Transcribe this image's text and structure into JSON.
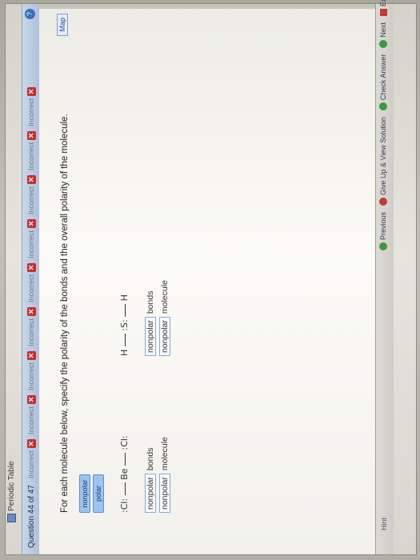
{
  "header": {
    "periodic_label": "Periodic Table"
  },
  "scorebar": {
    "question": "Question 44 of 47",
    "marks": [
      {
        "label": "Incorrect"
      },
      {
        "label": "Incorrect"
      },
      {
        "label": "Incorrect"
      },
      {
        "label": "Incorrect"
      },
      {
        "label": "Incorrect"
      },
      {
        "label": "Incorrect"
      },
      {
        "label": "Incorrect"
      },
      {
        "label": "Incorrect"
      },
      {
        "label": "Incorrect"
      }
    ],
    "help": "?"
  },
  "main": {
    "map_label": "Map",
    "prompt": "For each molecule below, specify the polarity of the bonds and the overall polarity of the molecule.",
    "chips": [
      "nonpolar",
      "polar"
    ],
    "molecules": [
      {
        "formula_left": ":Cl:",
        "center": "Be",
        "formula_right": ":Cl:",
        "bonds_value": "nonpolar",
        "bonds_label": "bonds",
        "molecule_value": "nonpolar",
        "molecule_label": "molecule"
      },
      {
        "formula_left": "H",
        "center": ":S:",
        "formula_right": "H",
        "bonds_value": "nonpolar",
        "bonds_label": "bonds",
        "molecule_value": "nonpolar",
        "molecule_label": "molecule"
      }
    ]
  },
  "bottombar": {
    "hint": "Hint",
    "previous": "Previous",
    "give_up": "Give Up & View Solution",
    "check": "Check Answer",
    "next": "Next",
    "exit": "Exit"
  }
}
